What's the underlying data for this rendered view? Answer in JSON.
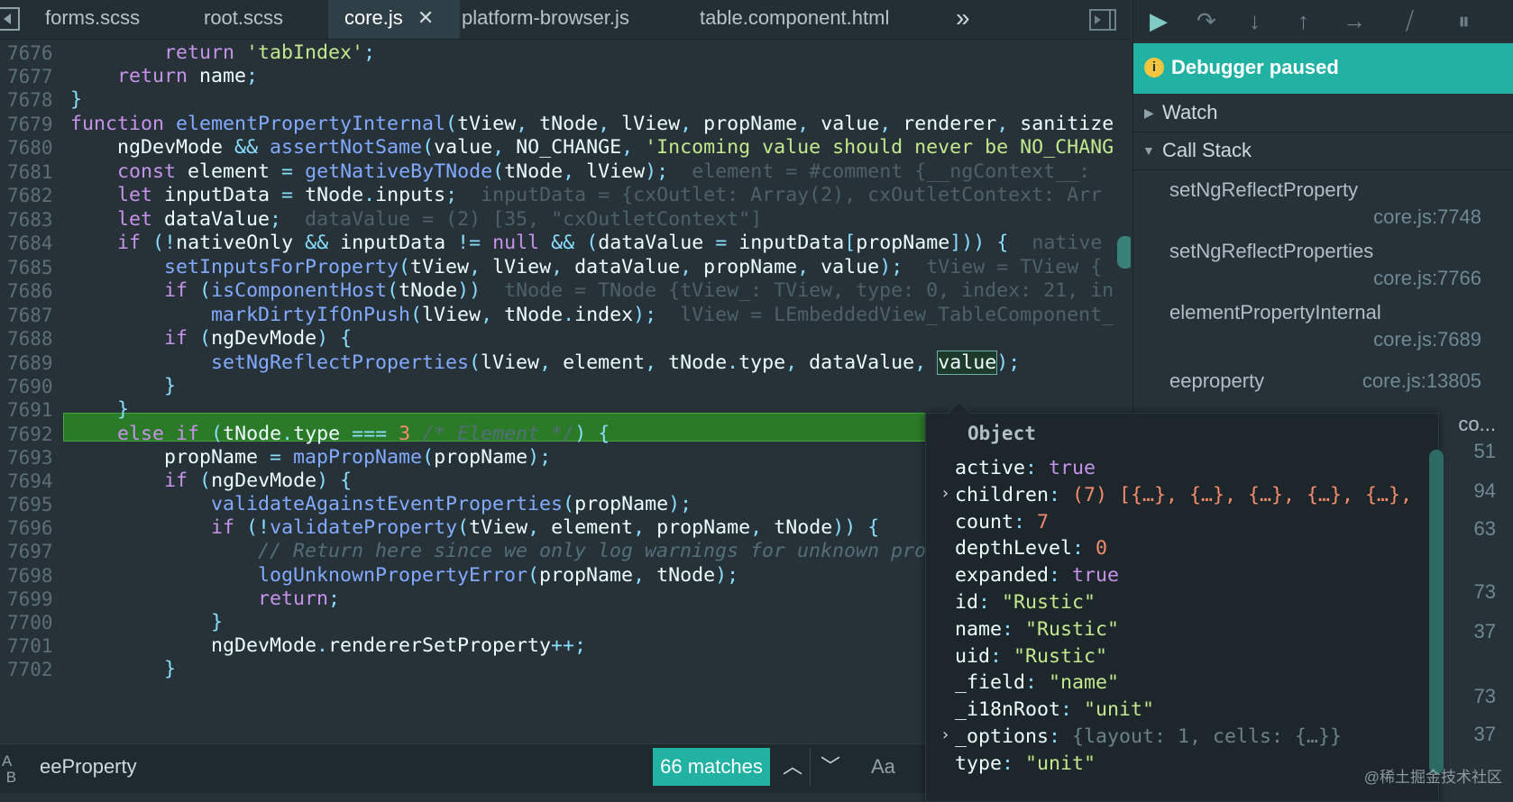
{
  "tabs": [
    {
      "label": "forms.scss",
      "active": false
    },
    {
      "label": "root.scss",
      "active": false
    },
    {
      "label": "core.js",
      "active": true
    },
    {
      "label": "platform-browser.js",
      "active": false
    },
    {
      "label": "table.component.html",
      "active": false
    }
  ],
  "tab_overflow_icon": "double-chevron-right-icon",
  "line_numbers": [
    "7676",
    "7677",
    "7678",
    "7679",
    "7680",
    "7681",
    "7682",
    "7683",
    "7684",
    "7685",
    "7686",
    "7687",
    "7688",
    "7689",
    "7690",
    "7691",
    "7692",
    "7693",
    "7694",
    "7695",
    "7696",
    "7697",
    "7698",
    "7699",
    "7700",
    "7701",
    "7702"
  ],
  "inline_values": {
    "l7681": "element = #comment {__ngContext__: ",
    "l7682": "inputData = {cxOutlet: Array(2), cxOutletContext: Arr",
    "l7683": "dataValue = (2) [35, \"cxOutletContext\"]",
    "l7684": "native",
    "l7685": "tView = TView {",
    "l7686": "tNode = TNode {tView_: TView, type: 0, index: 21, in",
    "l7687": "lView = LEmbeddedView_TableComponent_"
  },
  "code_strings": {
    "tabIndex": "'tabIndex'",
    "incoming": "'Incoming value should never be NO_CHANG",
    "element_comment": "/* Element */",
    "return_comment": "// Return here since we only log warnings for unknown pro"
  },
  "search": {
    "value": "eeProperty",
    "matches": "66 matches",
    "case_label": "Aa"
  },
  "debugger": {
    "status": "Debugger paused",
    "watch_label": "Watch",
    "callstack_label": "Call Stack",
    "frames": [
      {
        "name": "setNgReflectProperty",
        "location": "core.js:7748"
      },
      {
        "name": "setNgReflectProperties",
        "location": "core.js:7766"
      },
      {
        "name": "elementPropertyInternal",
        "location": "core.js:7689"
      },
      {
        "name": "eeproperty",
        "location": "core.js:13805"
      }
    ],
    "partial_frame_fragments": [
      "co...",
      "51",
      "94",
      "63",
      "73",
      "37",
      "73",
      "37"
    ]
  },
  "popover": {
    "title": "Object",
    "props": [
      {
        "key": "active",
        "value": "true",
        "kind": "bool",
        "expandable": false
      },
      {
        "key": "children",
        "value": "(7) [{…}, {…}, {…}, {…}, {…},",
        "kind": "array",
        "expandable": true
      },
      {
        "key": "count",
        "value": "7",
        "kind": "num",
        "expandable": false
      },
      {
        "key": "depthLevel",
        "value": "0",
        "kind": "num",
        "expandable": false
      },
      {
        "key": "expanded",
        "value": "true",
        "kind": "bool",
        "expandable": false
      },
      {
        "key": "id",
        "value": "\"Rustic\"",
        "kind": "str",
        "expandable": false
      },
      {
        "key": "name",
        "value": "\"Rustic\"",
        "kind": "str",
        "expandable": false
      },
      {
        "key": "uid",
        "value": "\"Rustic\"",
        "kind": "str",
        "expandable": false
      },
      {
        "key": "_field",
        "value": "\"name\"",
        "kind": "str",
        "expandable": false
      },
      {
        "key": "_i18nRoot",
        "value": "\"unit\"",
        "kind": "str",
        "expandable": false
      },
      {
        "key": "_options",
        "value": "{layout: 1, cells: {…}}",
        "kind": "obj",
        "expandable": true
      },
      {
        "key": "type",
        "value": "\"unit\"",
        "kind": "str",
        "expandable": false
      }
    ]
  },
  "watermark": "@稀土掘金技术社区",
  "colors": {
    "accent": "#21b2a3",
    "highlight_line": "#2b7a28",
    "background": "#263238"
  }
}
